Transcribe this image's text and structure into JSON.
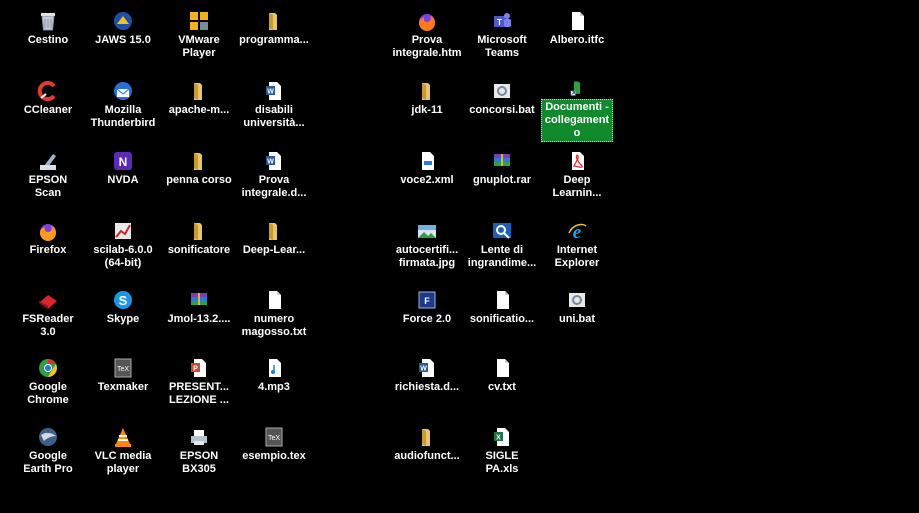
{
  "desktop": {
    "icons": [
      {
        "label": "Cestino",
        "icon": "recycle-bin-icon"
      },
      {
        "label": "JAWS 15.0",
        "icon": "jaws-icon"
      },
      {
        "label": "VMware\nPlayer",
        "icon": "vmware-icon"
      },
      {
        "label": "programma...",
        "icon": "folder-icon"
      },
      {
        "label": "Prova\nintegrale.htm",
        "icon": "firefox-html-icon"
      },
      {
        "label": "Microsoft\nTeams",
        "icon": "teams-icon"
      },
      {
        "label": "Albero.itfc",
        "icon": "document-icon"
      },
      {
        "label": "CCleaner",
        "icon": "ccleaner-icon"
      },
      {
        "label": "Mozilla\nThunderbird",
        "icon": "thunderbird-icon"
      },
      {
        "label": "apache-m...",
        "icon": "folder-icon"
      },
      {
        "label": "disabili\nuniversità...",
        "icon": "word-doc-icon"
      },
      {
        "label": "jdk-11",
        "icon": "folder-icon"
      },
      {
        "label": "concorsi.bat",
        "icon": "batch-file-icon"
      },
      {
        "label": "Documenti -\ncollegament\no",
        "icon": "shortcut-folder-icon"
      },
      {
        "label": "EPSON\nScan",
        "icon": "epson-scan-icon"
      },
      {
        "label": "NVDA",
        "icon": "nvda-icon"
      },
      {
        "label": "penna corso",
        "icon": "folder-icon"
      },
      {
        "label": "Prova\nintegrale.d...",
        "icon": "word-doc-icon"
      },
      {
        "label": "voce2.xml",
        "icon": "xml-file-icon"
      },
      {
        "label": "gnuplot.rar",
        "icon": "rar-archive-icon"
      },
      {
        "label": "Deep\nLearnin...",
        "icon": "pdf-icon"
      },
      {
        "label": "Firefox",
        "icon": "firefox-icon"
      },
      {
        "label": "scilab-6.0.0\n(64-bit)",
        "icon": "scilab-icon"
      },
      {
        "label": "sonificatore",
        "icon": "folder-icon"
      },
      {
        "label": "Deep-Lear...",
        "icon": "folder-icon"
      },
      {
        "label": "autocertifi...\nfirmata.jpg",
        "icon": "image-file-icon"
      },
      {
        "label": "Lente di\ningrandime...",
        "icon": "magnifier-icon"
      },
      {
        "label": "Internet\nExplorer",
        "icon": "internet-explorer-icon"
      },
      {
        "label": "FSReader\n3.0",
        "icon": "fsreader-icon"
      },
      {
        "label": "Skype",
        "icon": "skype-icon"
      },
      {
        "label": "Jmol-13.2....",
        "icon": "rar-archive-icon"
      },
      {
        "label": "numero\nmagosso.txt",
        "icon": "text-file-icon"
      },
      {
        "label": "Force 2.0",
        "icon": "force-app-icon"
      },
      {
        "label": "sonificatio...",
        "icon": "document-icon"
      },
      {
        "label": "uni.bat",
        "icon": "batch-file-icon"
      },
      {
        "label": "Google\nChrome",
        "icon": "chrome-icon"
      },
      {
        "label": "Texmaker",
        "icon": "texmaker-icon"
      },
      {
        "label": "PRESENT...\nLEZIONE ...",
        "icon": "powerpoint-icon"
      },
      {
        "label": "4.mp3",
        "icon": "audio-file-icon"
      },
      {
        "label": "richiesta.d...",
        "icon": "word-doc-icon"
      },
      {
        "label": "cv.txt",
        "icon": "text-file-icon"
      },
      {
        "label": "Google\nEarth Pro",
        "icon": "google-earth-icon"
      },
      {
        "label": "VLC media\nplayer",
        "icon": "vlc-icon"
      },
      {
        "label": "EPSON\nBX305",
        "icon": "printer-icon"
      },
      {
        "label": "esempio.tex",
        "icon": "tex-file-icon"
      },
      {
        "label": "audiofunct...",
        "icon": "folder-icon"
      },
      {
        "label": "SIGLE\nPA.xls",
        "icon": "excel-file-icon"
      }
    ]
  }
}
